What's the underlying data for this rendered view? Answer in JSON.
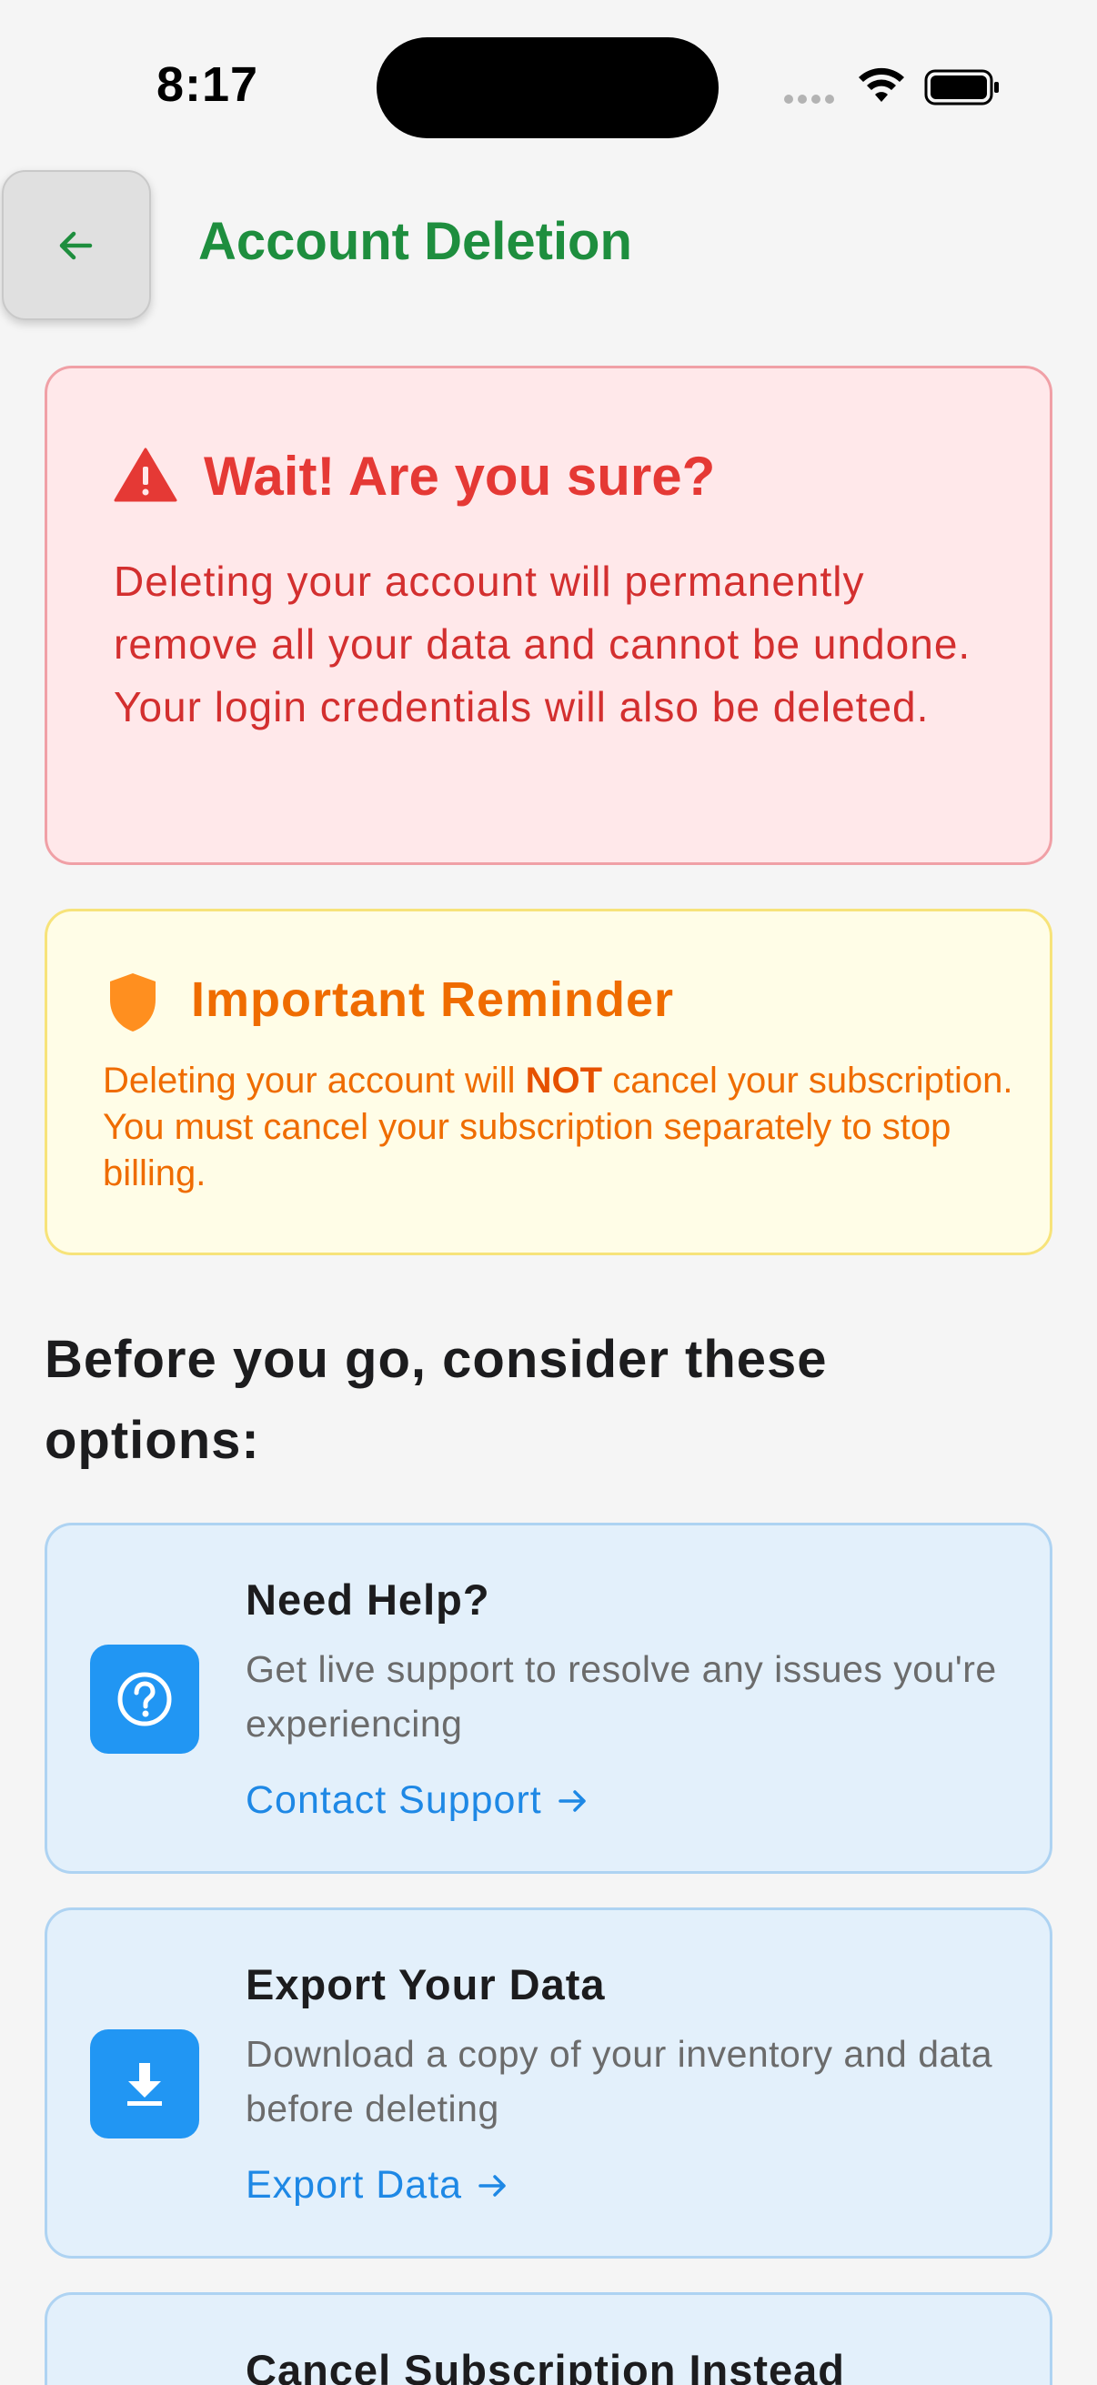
{
  "status_bar": {
    "time": "8:17"
  },
  "header": {
    "title": "Account Deletion"
  },
  "warning": {
    "title": "Wait! Are you sure?",
    "text": "Deleting your account will permanently remove all your data and cannot be undone. Your login credentials will also be deleted."
  },
  "reminder": {
    "title": "Important Reminder",
    "text_before": "Deleting your account will ",
    "text_bold": "NOT",
    "text_after": " cancel your subscription. You must cancel your subscription separately to stop billing."
  },
  "section_heading": "Before you go, consider these options:",
  "options": [
    {
      "title": "Need Help?",
      "description": "Get live support to resolve any issues you're experiencing",
      "link": "Contact Support",
      "icon": "question-circle-icon"
    },
    {
      "title": "Export Your Data",
      "description": "Download a copy of your inventory and data before deleting",
      "link": "Export Data",
      "icon": "download-icon"
    },
    {
      "title": "Cancel Subscription Instead"
    }
  ],
  "colors": {
    "title_green": "#1e8e3e",
    "warning_red": "#e53935",
    "reminder_orange": "#ef6c00",
    "accent_blue": "#2196f3",
    "link_blue": "#1e88e5"
  }
}
